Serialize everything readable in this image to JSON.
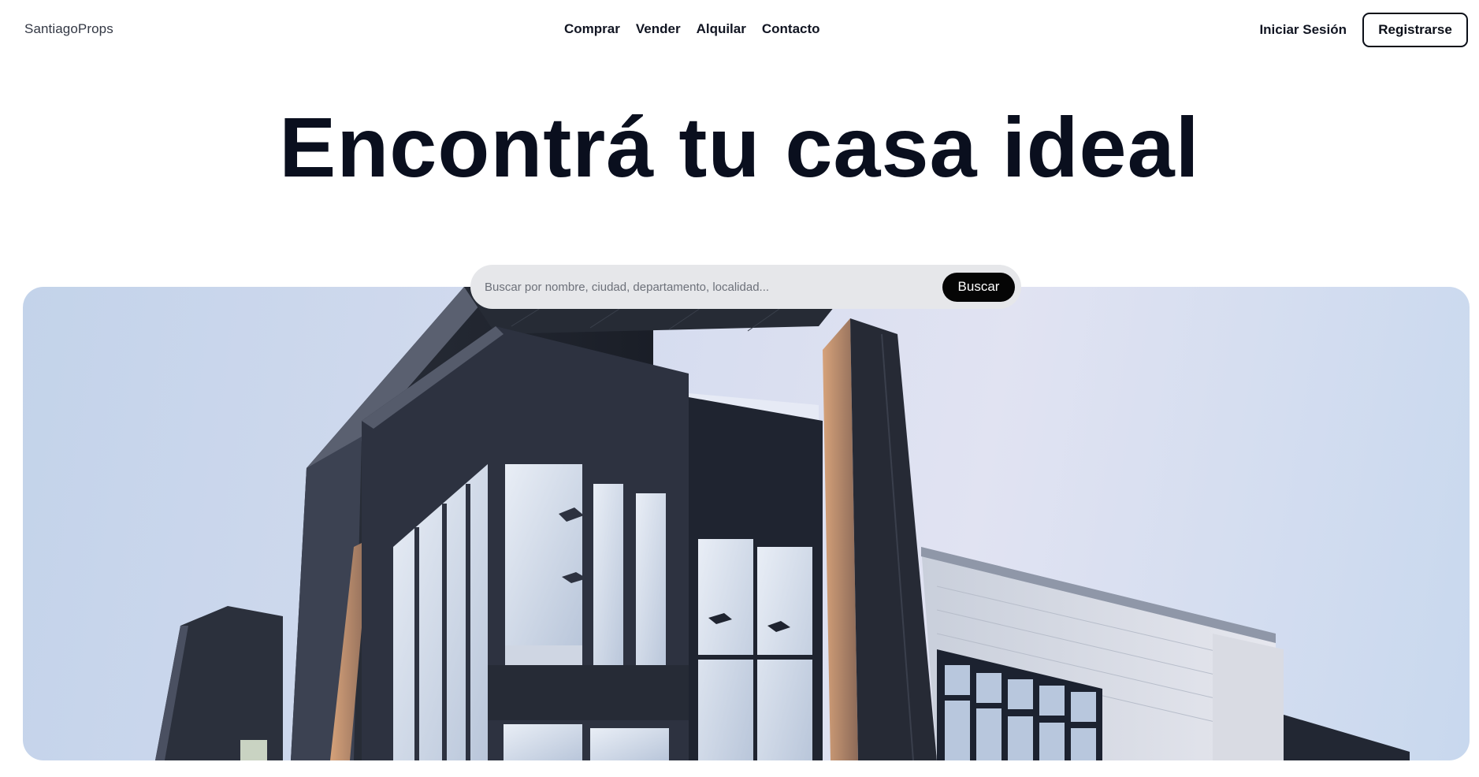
{
  "header": {
    "logo": "SantiagoProps",
    "nav": [
      {
        "label": "Comprar"
      },
      {
        "label": "Vender"
      },
      {
        "label": "Alquilar"
      },
      {
        "label": "Contacto"
      }
    ],
    "login_label": "Iniciar Sesión",
    "register_label": "Registrarse"
  },
  "hero": {
    "title": "Encontrá tu casa ideal",
    "image_icon": "building-photo"
  },
  "search": {
    "placeholder": "Buscar por nombre, ciudad, departamento, localidad...",
    "value": "",
    "button_label": "Buscar"
  },
  "colors": {
    "text": "#0a0f1e",
    "button_dark": "#050505",
    "search_bg": "#e6e7ea",
    "sky": "#d5dcef"
  }
}
